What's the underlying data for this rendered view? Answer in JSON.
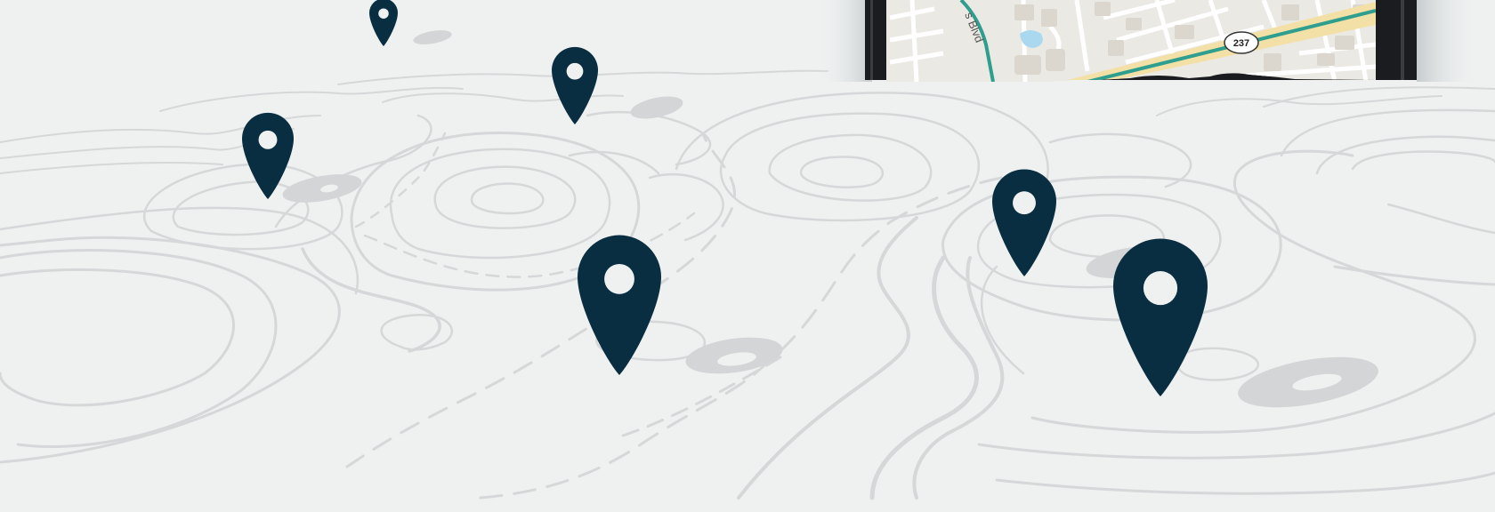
{
  "map_preview": {
    "street_label": "s Blvd",
    "route_shield": "237"
  },
  "pins": [
    {
      "name": "pin-1"
    },
    {
      "name": "pin-2"
    },
    {
      "name": "pin-3"
    },
    {
      "name": "pin-4"
    },
    {
      "name": "pin-5"
    },
    {
      "name": "pin-6"
    }
  ],
  "colors": {
    "background": "#eff1f1",
    "contour": "#d6d8d9",
    "pin": "#0a2e41",
    "pin_shadow": "#d2d4d5",
    "phone_frame": "#1b1c1f",
    "map_land": "#eceae5",
    "map_block": "#ddd9d1",
    "map_highway": "#f3e0a6",
    "map_route_line": "#2e9f8f",
    "map_water": "#aadaf0"
  }
}
